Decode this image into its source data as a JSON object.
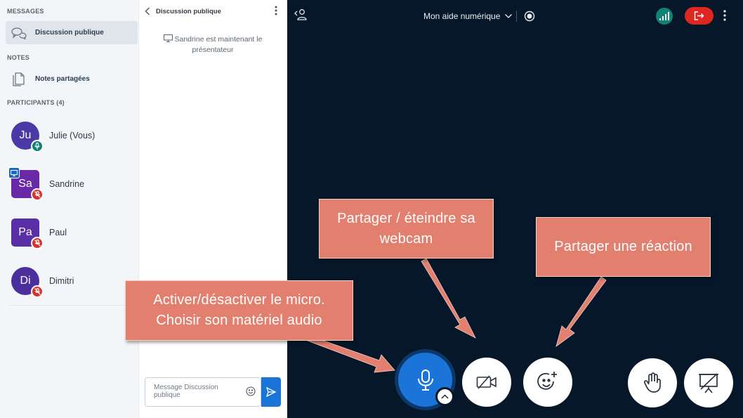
{
  "sidebar": {
    "messages_title": "MESSAGES",
    "public_chat_label": "Discussion publique",
    "notes_title": "NOTES",
    "shared_notes_label": "Notes partagées",
    "participants_title": "PARTICIPANTS (4)",
    "participants": [
      {
        "initials": "Ju",
        "name": "Julie (Vous)",
        "color": "#4b3aa6",
        "mic": "on",
        "presenter": false
      },
      {
        "initials": "Sa",
        "name": "Sandrine",
        "color": "#6a2aa8",
        "mic": "muted",
        "presenter": true
      },
      {
        "initials": "Pa",
        "name": "Paul",
        "color": "#5a2fa6",
        "mic": "muted",
        "presenter": false
      },
      {
        "initials": "Di",
        "name": "Dimitri",
        "color": "#4b2f9c",
        "mic": "muted",
        "presenter": false
      }
    ]
  },
  "chat": {
    "header_title": "Discussion publique",
    "system_message": "Sandrine est maintenant le présentateur",
    "input_placeholder": "Message Discussion publique"
  },
  "topbar": {
    "meeting_title": "Mon aide numérique"
  },
  "callouts": {
    "webcam": "Partager / éteindre sa webcam",
    "reaction": "Partager une réaction",
    "micro": "Activer/désactiver le micro. Choisir son matériel audio"
  },
  "colors": {
    "main_bg": "#06172a",
    "accent_blue": "#1b74d8",
    "leave_red": "#df2721",
    "signal_teal": "#0f8375",
    "callout_salmon": "#e27f6e",
    "mic_on_badge": "#0f8375",
    "mic_muted_badge": "#d9342b"
  },
  "icons": {
    "webcam_button": "video-off-icon",
    "reaction_button": "emoji-add-icon",
    "hand_button": "raise-hand-icon",
    "presentation_button": "presentation-off-icon",
    "mic_button": "microphone-icon"
  }
}
